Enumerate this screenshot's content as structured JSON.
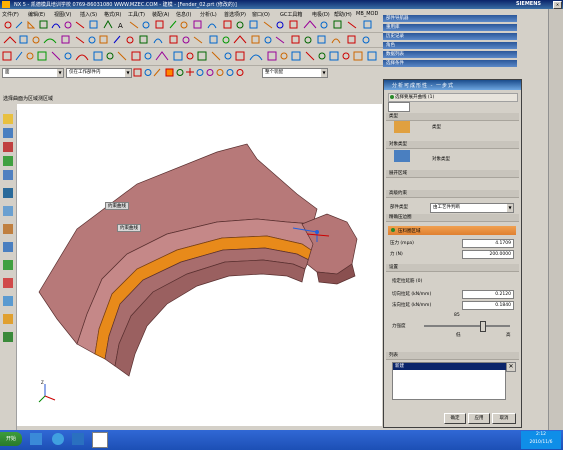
{
  "window": {
    "title": "NX 5 - 凯德模具培训学校 0769-86031080 WWW.MZEC.COM - 建模 - [Fender_02.prt (修改的)]",
    "brand": "SIEMENS"
  },
  "menubar": {
    "items": [
      "文件(F)",
      "编辑(E)",
      "视图(V)",
      "插入(S)",
      "格式(R)",
      "工具(T)",
      "装配(A)",
      "信息(I)",
      "分析(L)",
      "首选项(P)",
      "窗口(O)",
      "GC工具箱",
      "电极(D)",
      "帮助(H)",
      "MB_MOD"
    ]
  },
  "selectbar": {
    "filter": "面",
    "scope": "仅在工作部件内",
    "body_filter": "整个装配"
  },
  "cue": {
    "text": "选择曲面为区域测区域"
  },
  "right_panels": {
    "items": [
      "部件导航器",
      "重用库",
      "历史记录",
      "角色",
      "数据列表",
      "选择条件"
    ]
  },
  "dialog": {
    "title": "分析可成形性 - 一步式",
    "toggle_label": "选择要展开曲线 (1)",
    "sections": {
      "type_header": "类型",
      "type_value": "类型",
      "object_type_header": "对象类型",
      "object_type_value": "对象类型",
      "expand_region_header": "展开区域",
      "advanced_header": "高级约束",
      "component_type_label": "部件类型",
      "component_type_value": "由工艺件判断",
      "pressure_header": "精确压边圈",
      "pressure_toggle": "压料圈区域",
      "force_label": "压力 (mpa)",
      "force_value": "4.1709",
      "tension_label": "力 (N)",
      "tension_value": "200.0000",
      "settings_header": "设置",
      "slider_header": "指定拉延筋 (0)",
      "cut_force_label": "切向拉延 (kN/mm)",
      "cut_force_value": "0.2120",
      "normal_force_label": "法向拉延 (kN/mm)",
      "normal_force_value": "0.1840",
      "slider_value": "85",
      "slider_label": "力强度",
      "slider_low": "低",
      "slider_high": "高",
      "results_header": "列表",
      "result_row": "新建"
    },
    "buttons": {
      "ok": "确定",
      "apply": "应用",
      "cancel": "取消"
    }
  },
  "viewport": {
    "labels": [
      "约束曲线",
      "约束曲线"
    ]
  },
  "taskbar": {
    "start": "开始",
    "time": "2:12",
    "date": "2010/11/6"
  }
}
